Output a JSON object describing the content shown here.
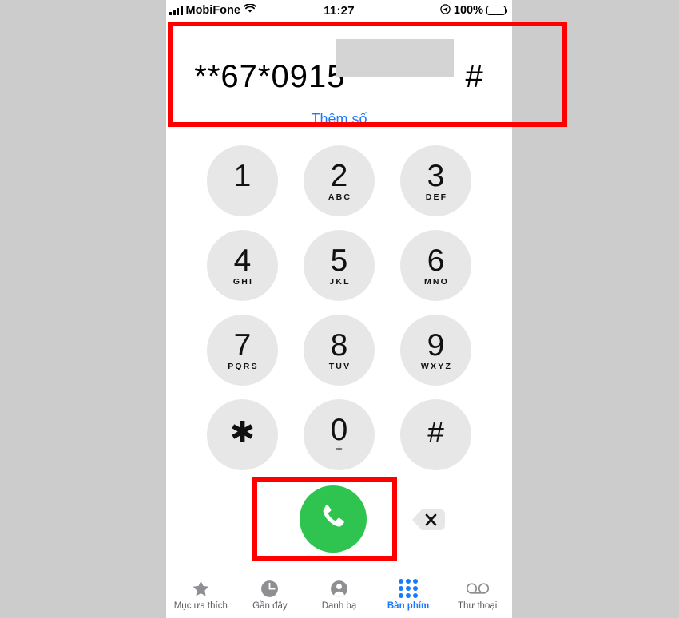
{
  "app": {
    "name": "Phone",
    "platform": "iOS"
  },
  "status_bar": {
    "carrier": "MobiFone",
    "signal_icon": "signal-bars-icon",
    "wifi_icon": "wifi-icon",
    "time": "11:27",
    "location_icon": "location-arrow-icon",
    "battery_percent": "100%",
    "battery_icon": "battery-full-icon"
  },
  "number_display": {
    "dialed_prefix": "**67*0915",
    "dialed_suffix": "#",
    "redacted": true,
    "add_number_label": "Thêm số"
  },
  "keypad": {
    "rows": [
      [
        {
          "digit": "1",
          "letters": ""
        },
        {
          "digit": "2",
          "letters": "ABC"
        },
        {
          "digit": "3",
          "letters": "DEF"
        }
      ],
      [
        {
          "digit": "4",
          "letters": "GHI"
        },
        {
          "digit": "5",
          "letters": "JKL"
        },
        {
          "digit": "6",
          "letters": "MNO"
        }
      ],
      [
        {
          "digit": "7",
          "letters": "PQRS"
        },
        {
          "digit": "8",
          "letters": "TUV"
        },
        {
          "digit": "9",
          "letters": "WXYZ"
        }
      ],
      [
        {
          "digit": "✱",
          "letters": ""
        },
        {
          "digit": "0",
          "letters": "+"
        },
        {
          "digit": "#",
          "letters": ""
        }
      ]
    ]
  },
  "actions": {
    "call_icon": "phone-handset-icon",
    "call_color": "#2EC44F",
    "backspace_icon": "backspace-delete-icon"
  },
  "tab_bar": {
    "items": [
      {
        "label": "Mục ưa thích",
        "icon": "star-icon",
        "active": false
      },
      {
        "label": "Gần đây",
        "icon": "clock-icon",
        "active": false
      },
      {
        "label": "Danh bạ",
        "icon": "person-circle-icon",
        "active": false
      },
      {
        "label": "Bàn phím",
        "icon": "keypad-dots-icon",
        "active": true
      },
      {
        "label": "Thư thoại",
        "icon": "voicemail-icon",
        "active": false
      }
    ]
  },
  "annotations": {
    "accent_color": "#FF0000",
    "boxes": [
      {
        "name": "number-display-highlight"
      },
      {
        "name": "call-button-highlight"
      }
    ]
  }
}
